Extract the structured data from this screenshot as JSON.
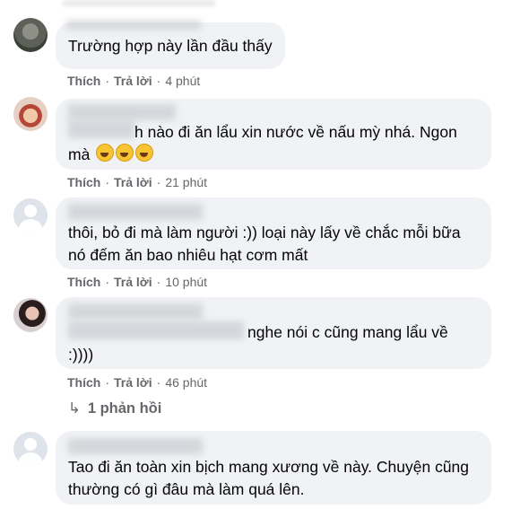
{
  "comments": [
    {
      "text": "Trường hợp này lần đầu thấy",
      "like": "Thích",
      "reply": "Trả lời",
      "time": "4 phút"
    },
    {
      "text": "h nào đi ăn lẩu xin nước về nấu mỳ nhá. Ngon",
      "text2": "mà",
      "like": "Thích",
      "reply": "Trả lời",
      "time": "21 phút"
    },
    {
      "text": "thôi, bỏ đi mà làm người :)) loại này lấy về chắc mỗi bữa",
      "text2": "nó đếm ăn bao nhiêu hạt cơm mất",
      "like": "Thích",
      "reply": "Trả lời",
      "time": "10 phút"
    },
    {
      "text": "nghe nói c cũng mang lẩu về",
      "text2": ":))))",
      "like": "Thích",
      "reply": "Trả lời",
      "time": "46 phút"
    },
    {
      "text": "Tao đi ăn toàn xin bịch mang xương về này. Chuyện cũng",
      "text2": "thường có gì đâu mà làm quá lên."
    }
  ],
  "replies_link": "1 phản hồi",
  "emoji_name": "rolling-on-floor-laughing-emoji"
}
